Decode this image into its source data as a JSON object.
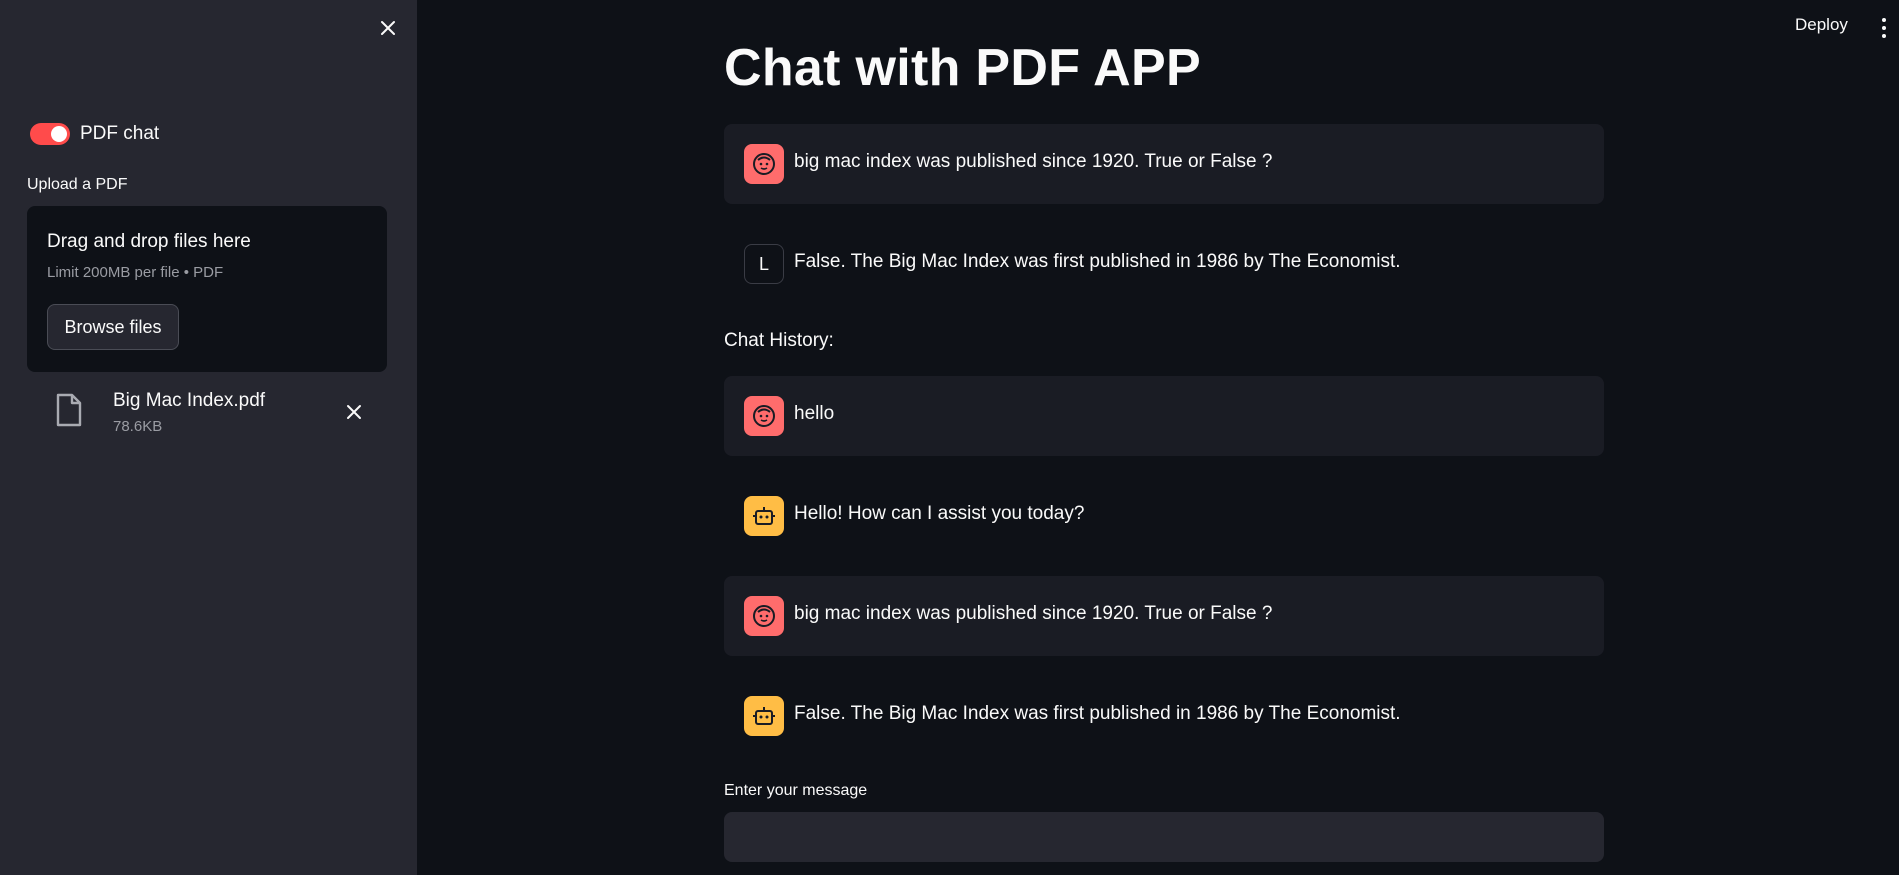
{
  "sidebar": {
    "toggle": {
      "label": "PDF chat",
      "on": true
    },
    "upload_label": "Upload a PDF",
    "dropzone": {
      "title": "Drag and drop files here",
      "subtitle": "Limit 200MB per file • PDF",
      "browse_label": "Browse files"
    },
    "file": {
      "name": "Big Mac Index.pdf",
      "size": "78.6KB"
    }
  },
  "header": {
    "deploy_label": "Deploy"
  },
  "main": {
    "title": "Chat with PDF APP",
    "current": {
      "user": "big mac index was published since 1920. True or False ?",
      "assistant_avatar": "L",
      "assistant": "False. The Big Mac Index was first published in 1986 by The Economist."
    },
    "history_label": "Chat History:",
    "history": [
      {
        "role": "user",
        "text": "hello"
      },
      {
        "role": "assistant",
        "text": "Hello! How can I assist you today?"
      },
      {
        "role": "user",
        "text": "big mac index was published since 1920. True or False ?"
      },
      {
        "role": "assistant",
        "text": "False. The Big Mac Index was first published in 1986 by The Economist."
      }
    ],
    "input_label": "Enter your message",
    "input_value": ""
  },
  "colors": {
    "accent": "#ff4b4b",
    "user_avatar": "#ff6c6c",
    "bot_avatar": "#ffbd45",
    "sidebar_bg": "#262730",
    "main_bg": "#0e1117"
  }
}
